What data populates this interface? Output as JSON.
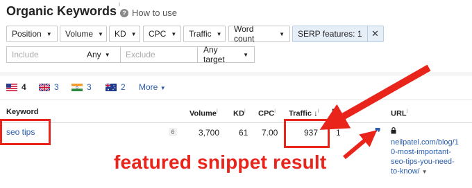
{
  "title": "Organic Keywords",
  "title_info": "i",
  "how_to": "How to use",
  "filters": [
    "Position",
    "Volume",
    "KD",
    "CPC",
    "Traffic",
    "Word count"
  ],
  "serp_filter": "SERP features: 1",
  "include_placeholder": "Include",
  "include_any": "Any",
  "exclude_placeholder": "Exclude",
  "any_target": "Any target",
  "country_tabs": [
    {
      "flag": "us-flag",
      "count": "4"
    },
    {
      "flag": "uk-flag",
      "count": "3"
    },
    {
      "flag": "in-flag",
      "count": "3"
    },
    {
      "flag": "au-flag",
      "count": "2"
    }
  ],
  "more_label": "More",
  "columns": {
    "keyword": "Keyword",
    "volume": "Volume",
    "kd": "KD",
    "cpc": "CPC",
    "traffic": "Traffic",
    "position": "P",
    "url": "URL"
  },
  "row": {
    "keyword": "seo tips",
    "serp_count": "6",
    "volume": "3,700",
    "kd": "61",
    "cpc": "7.00",
    "traffic": "937",
    "position": "1",
    "url_lines": [
      "neilpatel.com/blog/1",
      "0-most-important-",
      "seo-tips-you-need-",
      "to-know/"
    ]
  },
  "annotation": "featured snippet result",
  "colors": {
    "accent": "#e8241b",
    "link": "#2a5db0"
  }
}
